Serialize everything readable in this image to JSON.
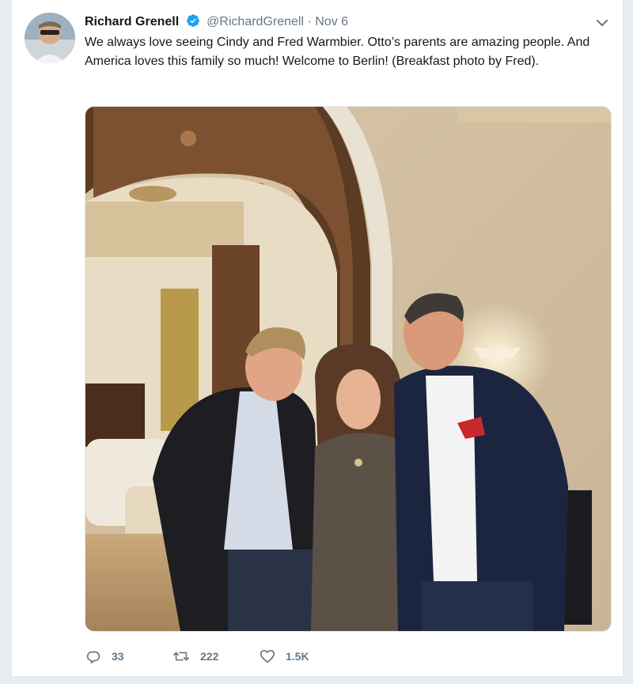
{
  "tweet": {
    "author_name": "Richard Grenell",
    "handle": "@RichardGrenell",
    "separator": "·",
    "date": "Nov 6",
    "text": "We always love seeing Cindy and Fred Warmbier. Otto’s parents are amazing people. And America loves this family so much! Welcome to Berlin! (Breakfast photo by Fred).",
    "verified": true,
    "photo_alt": "",
    "colors": {
      "verified_blue": "#1da1f2",
      "meta_gray": "#657786",
      "text_dark": "#14171a"
    }
  },
  "actions": {
    "reply_icon": "reply-icon",
    "reply_count": "33",
    "retweet_icon": "retweet-icon",
    "retweet_count": "222",
    "like_icon": "heart-icon",
    "like_count": "1.5K"
  },
  "icons": {
    "menu": "chevron-down-icon",
    "verified": "verified-badge-icon"
  }
}
